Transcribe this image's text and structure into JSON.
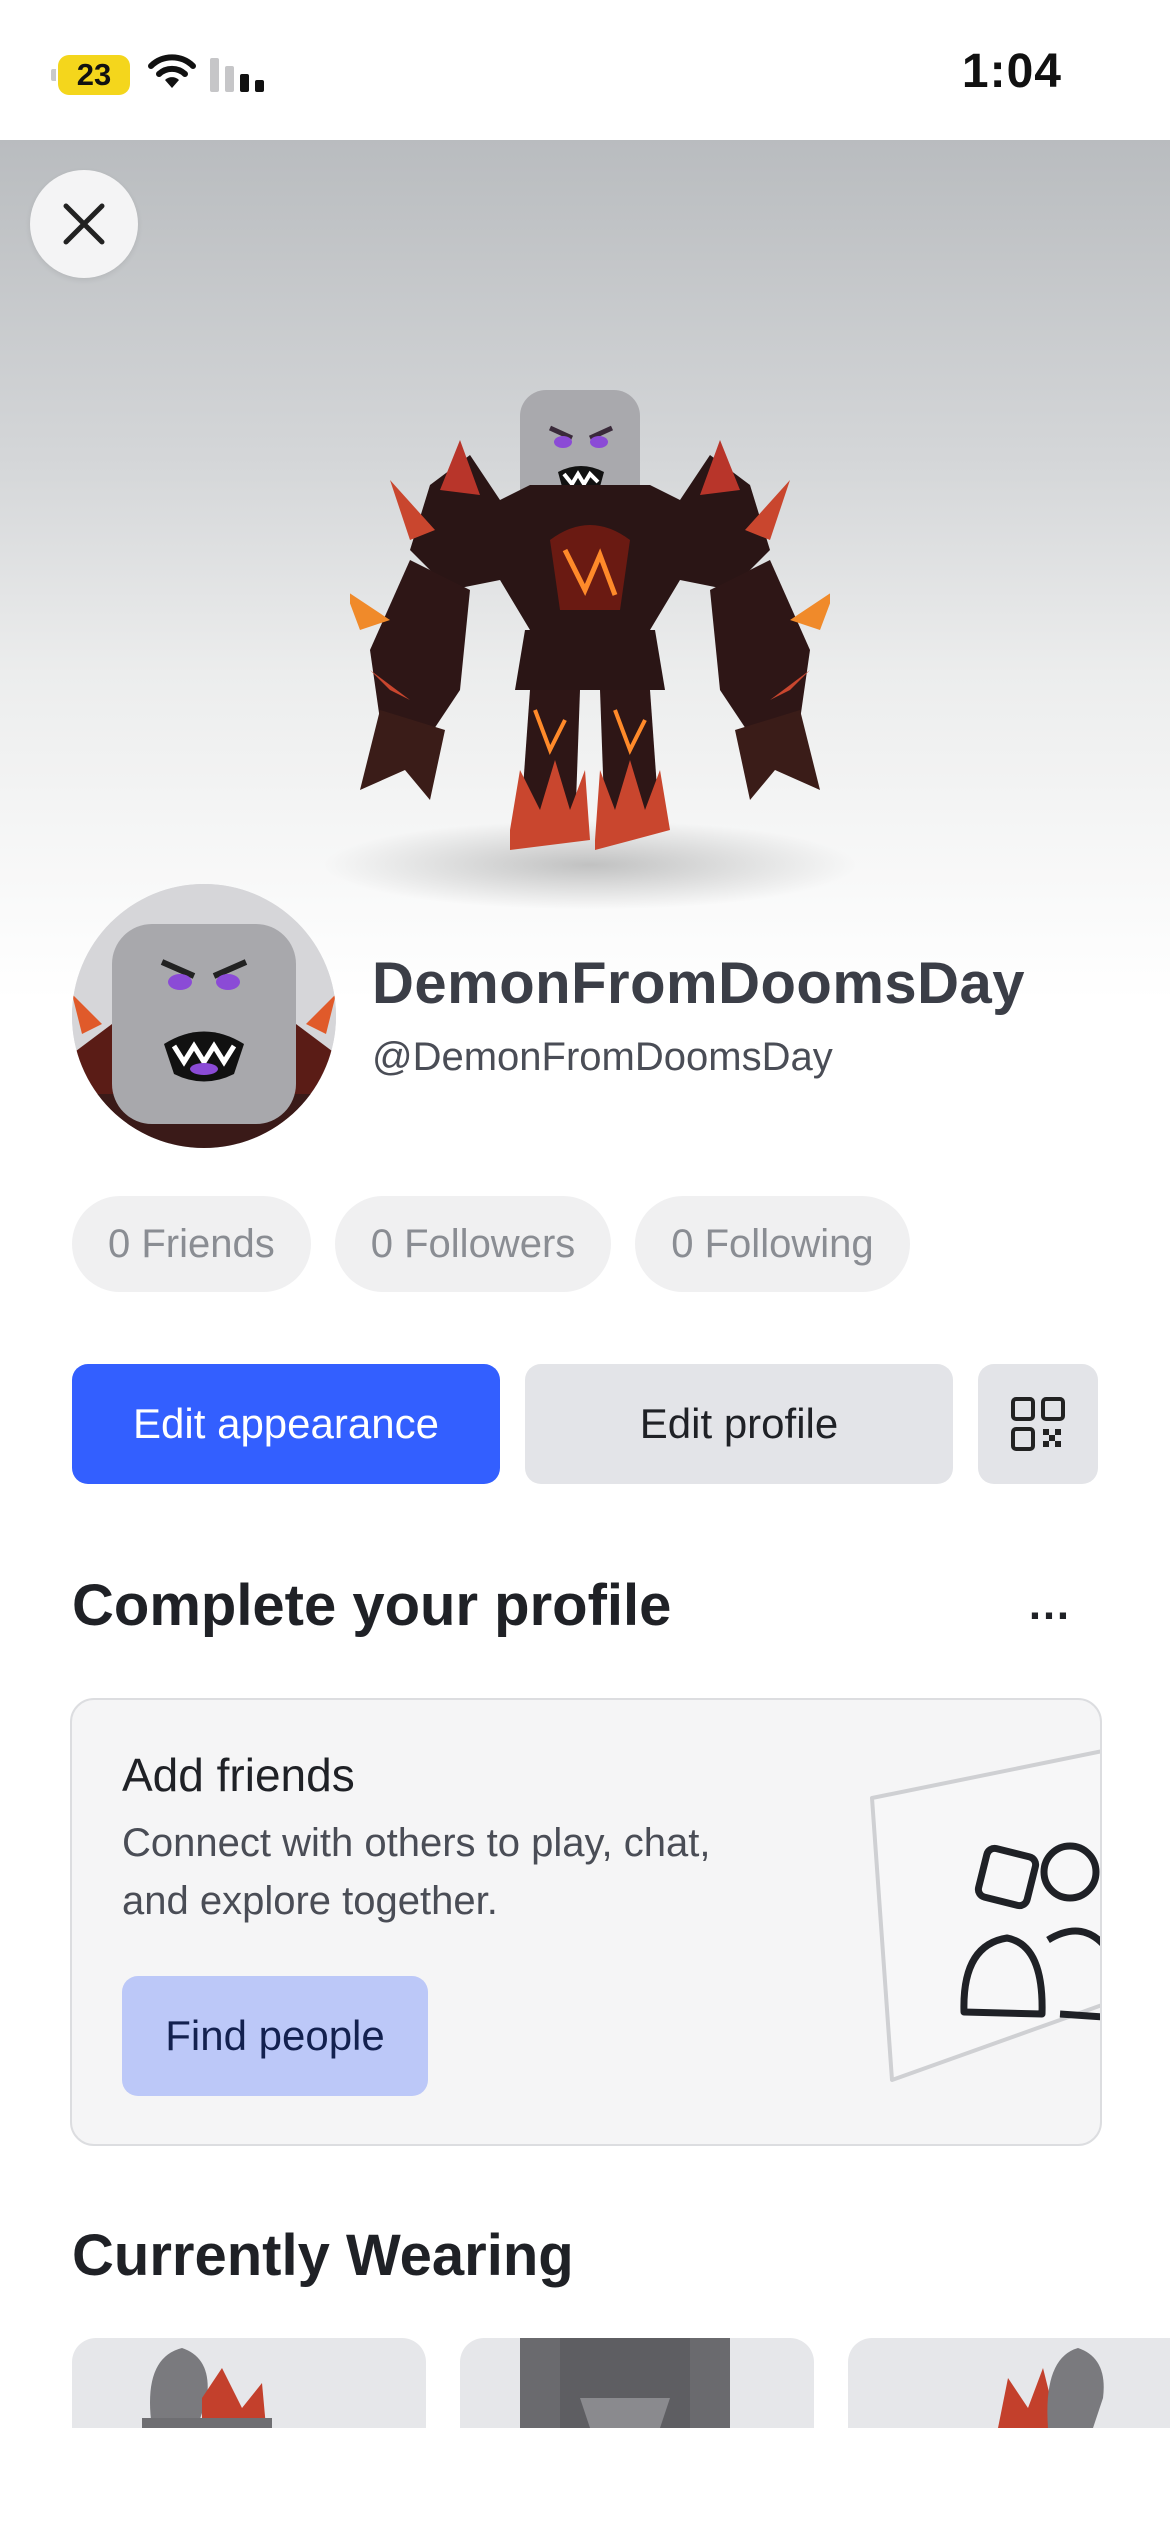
{
  "status_bar": {
    "battery_level": "23",
    "time": "1:04"
  },
  "profile": {
    "display_name": "DemonFromDoomsDay",
    "username": "@DemonFromDoomsDay"
  },
  "stats": {
    "friends": "0 Friends",
    "followers": "0 Followers",
    "following": "0 Following"
  },
  "actions": {
    "edit_appearance": "Edit appearance",
    "edit_profile": "Edit profile"
  },
  "complete_profile": {
    "title": "Complete your profile",
    "more_label": "…",
    "card": {
      "title": "Add friends",
      "description": "Connect with others to play, chat, and explore together.",
      "button": "Find people"
    }
  },
  "currently_wearing": {
    "title": "Currently Wearing"
  },
  "colors": {
    "primary": "#335fff",
    "secondary": "#e3e4e8",
    "find_people_bg": "#bcc8f8"
  },
  "icons": {
    "close": "close-icon",
    "qr": "qr-code-icon",
    "more": "more-horizontal-icon",
    "friends": "people-icon"
  }
}
